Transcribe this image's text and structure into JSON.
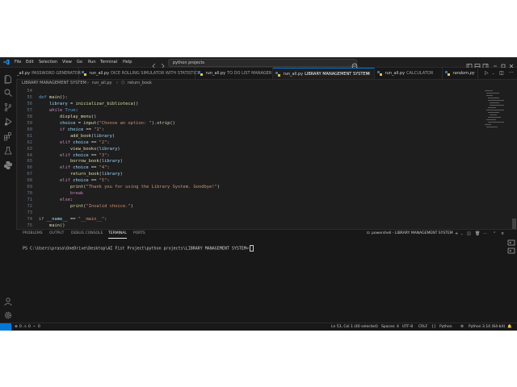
{
  "menu": [
    "File",
    "Edit",
    "Selection",
    "View",
    "Go",
    "Run",
    "Terminal",
    "Help"
  ],
  "command_center": {
    "text": "python projects"
  },
  "tabs": [
    {
      "file": "_all.py",
      "desc": "PASSWORD GENERATOR",
      "active": false
    },
    {
      "file": "run_all.py",
      "desc": "DICE ROLLING SIMULATOR WITH STATISTICS",
      "active": false
    },
    {
      "file": "run_all.py",
      "desc": "TO DO LIST MANAGER",
      "active": false
    },
    {
      "file": "run_all.py",
      "desc": "LIBRARY MANAGEMENT SYSTEM",
      "active": true
    },
    {
      "file": "run_all.py",
      "desc": "CALCULATOR",
      "active": false
    },
    {
      "file": "random.py",
      "desc": "",
      "active": false
    }
  ],
  "breadcrumb": {
    "folder": "LIBRARY MANAGEMENT SYSTEM",
    "file": "run_all.py",
    "symbol": "return_book"
  },
  "code": [
    {
      "n": "54",
      "html": ""
    },
    {
      "n": "55",
      "html": "<span class='kw2'>def</span> <span class='fn'>main</span>():"
    },
    {
      "n": "56",
      "html": "    <span class='var'>library</span> = <span class='fn'>inicializar_biblioteca</span>()"
    },
    {
      "n": "57",
      "html": "    <span class='kw'>while</span> <span class='kw2'>True</span>:"
    },
    {
      "n": "58",
      "html": "        <span class='fn'>display_menu</span>()"
    },
    {
      "n": "59",
      "html": "        <span class='var'>choice</span> = <span class='fn'>input</span>(<span class='str'>\"Choose an option: \"</span>).<span class='fn'>strip</span>()"
    },
    {
      "n": "60",
      "html": "        <span class='kw'>if</span> <span class='var'>choice</span> == <span class='str'>\"1\"</span>:"
    },
    {
      "n": "61",
      "html": "            <span class='fn'>add_book</span>(<span class='var'>library</span>)"
    },
    {
      "n": "62",
      "html": "        <span class='kw'>elif</span> <span class='var'>choice</span> == <span class='str'>\"2\"</span>:"
    },
    {
      "n": "63",
      "html": "            <span class='fn'>view_books</span>(<span class='var'>library</span>)"
    },
    {
      "n": "64",
      "html": "        <span class='kw'>elif</span> <span class='var'>choice</span> == <span class='str'>\"3\"</span>:"
    },
    {
      "n": "65",
      "html": "            <span class='fn'>borrow_book</span>(<span class='var'>library</span>)"
    },
    {
      "n": "66",
      "html": "        <span class='kw'>elif</span> <span class='var'>choice</span> == <span class='str'>\"4\"</span>:"
    },
    {
      "n": "67",
      "html": "            <span class='fn'>return_book</span>(<span class='var'>library</span>)"
    },
    {
      "n": "68",
      "html": "        <span class='kw'>elif</span> <span class='var'>choice</span> == <span class='str'>\"5\"</span>:"
    },
    {
      "n": "69",
      "html": "            <span class='fn'>print</span>(<span class='str'>\"Thank you for using the Library System. Goodbye!\"</span>)"
    },
    {
      "n": "70",
      "html": "            <span class='kw'>break</span>"
    },
    {
      "n": "71",
      "html": "        <span class='kw'>else</span>:"
    },
    {
      "n": "72",
      "html": "            <span class='fn'>print</span>(<span class='str'>\"Invalid choice.\"</span>)"
    },
    {
      "n": "73",
      "html": ""
    },
    {
      "n": "74",
      "html": "<span class='kw'>if</span> <span class='var'>__name__</span> == <span class='str'>\"__main__\"</span>:"
    },
    {
      "n": "75",
      "html": "    <span class='fn'>main</span>()"
    }
  ],
  "panel": {
    "tabs": [
      "PROBLEMS",
      "OUTPUT",
      "DEBUG CONSOLE",
      "TERMINAL",
      "PORTS"
    ],
    "active_tab": "TERMINAL",
    "terminal_name": "powershell - LIBRARY MANAGEMENT SYSTEM",
    "prompt": "PS C:\\Users\\prasa\\OneDrive\\Desktop\\AI Fist Project\\python projects\\LIBRARY MANAGEMENT SYSTEM>"
  },
  "status": {
    "errors": "0",
    "warnings": "0",
    "ports": "0",
    "cursor_pos": "Ln 53, Col 1 (40 selected)",
    "spaces": "Spaces: 4",
    "encoding": "UTF-8",
    "eol": "CRLF",
    "language": "Python",
    "interpreter": "Python 3.14 (64-bit)"
  },
  "colors": {
    "accent": "#0078d4",
    "background": "#1e1e1e",
    "panel": "#181818"
  },
  "icons": [
    "vscode-logo-icon",
    "explorer-icon",
    "search-icon",
    "source-control-icon",
    "run-debug-icon",
    "extensions-icon",
    "testing-icon",
    "python-icon",
    "account-icon",
    "settings-icon"
  ]
}
